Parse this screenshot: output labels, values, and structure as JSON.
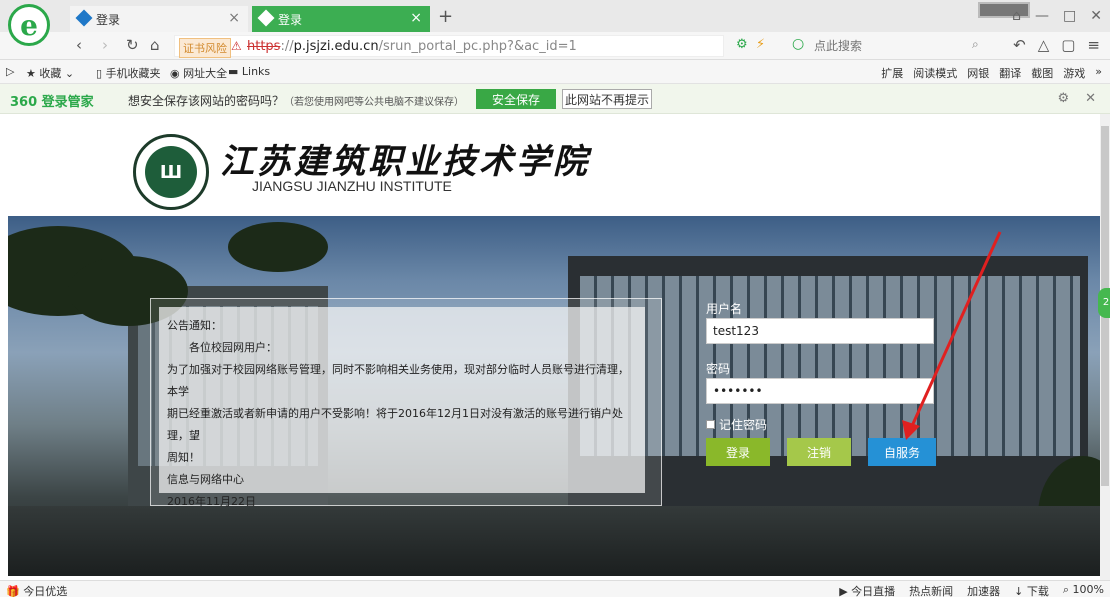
{
  "browser": {
    "logo": "e",
    "tabs": [
      {
        "title": "登录",
        "active": false
      },
      {
        "title": "登录",
        "active": true
      }
    ],
    "new_tab": "+"
  },
  "address_bar": {
    "cert_warning": "证书风险",
    "url_protocol": "https",
    "url_host": "p.jsjzi.edu.cn",
    "url_path": "/srun_portal_pc.php?&ac_id=1",
    "search_placeholder": "点此搜索"
  },
  "bookmarks": {
    "left": [
      "收藏",
      "手机收藏夹",
      "网址大全",
      "Links"
    ],
    "right": [
      "扩展",
      "阅读模式",
      "网银",
      "翻译",
      "截图",
      "游戏"
    ]
  },
  "password_bar": {
    "brand": "360 登录管家",
    "prompt": "想安全保存该网站的密码吗？",
    "sub": "（若您使用网吧等公共电脑不建议保存）",
    "save_button": "安全保存",
    "never_button": "此网站不再提示"
  },
  "school": {
    "name_cn": "江苏建筑职业技术学院",
    "name_en": "JIANGSU JIANZHU INSTITUTE"
  },
  "notice": {
    "title": "公告通知：",
    "greeting": "各位校园网用户：",
    "body_1": "为了加强对于校园网络账号管理，同时不影响相关业务使用，现对部分临时人员账号进行清理，本学",
    "body_2": "期已经重激活或者新申请的用户不受影响！将于2016年12月1日对没有激活的账号进行销户处理，望",
    "body_3": "周知！",
    "signature": "信息与网络中心",
    "date": "2016年11月22日"
  },
  "login": {
    "username_label": "用户名",
    "username_value": "test123",
    "password_label": "密码",
    "password_value": "•••••••",
    "remember_label": "记住密码",
    "login_button": "登录",
    "logout_button": "注销",
    "self_service_button": "自服务"
  },
  "statusbar": {
    "left": "今日优选",
    "items": [
      "今日直播",
      "热点新闻",
      "加速器",
      "下载"
    ],
    "zoom": "100%"
  },
  "colors": {
    "brand_green": "#2ba84a",
    "self_service_blue": "#2591d6",
    "login_green": "#8ab82a",
    "arrow_red": "#e02020"
  }
}
